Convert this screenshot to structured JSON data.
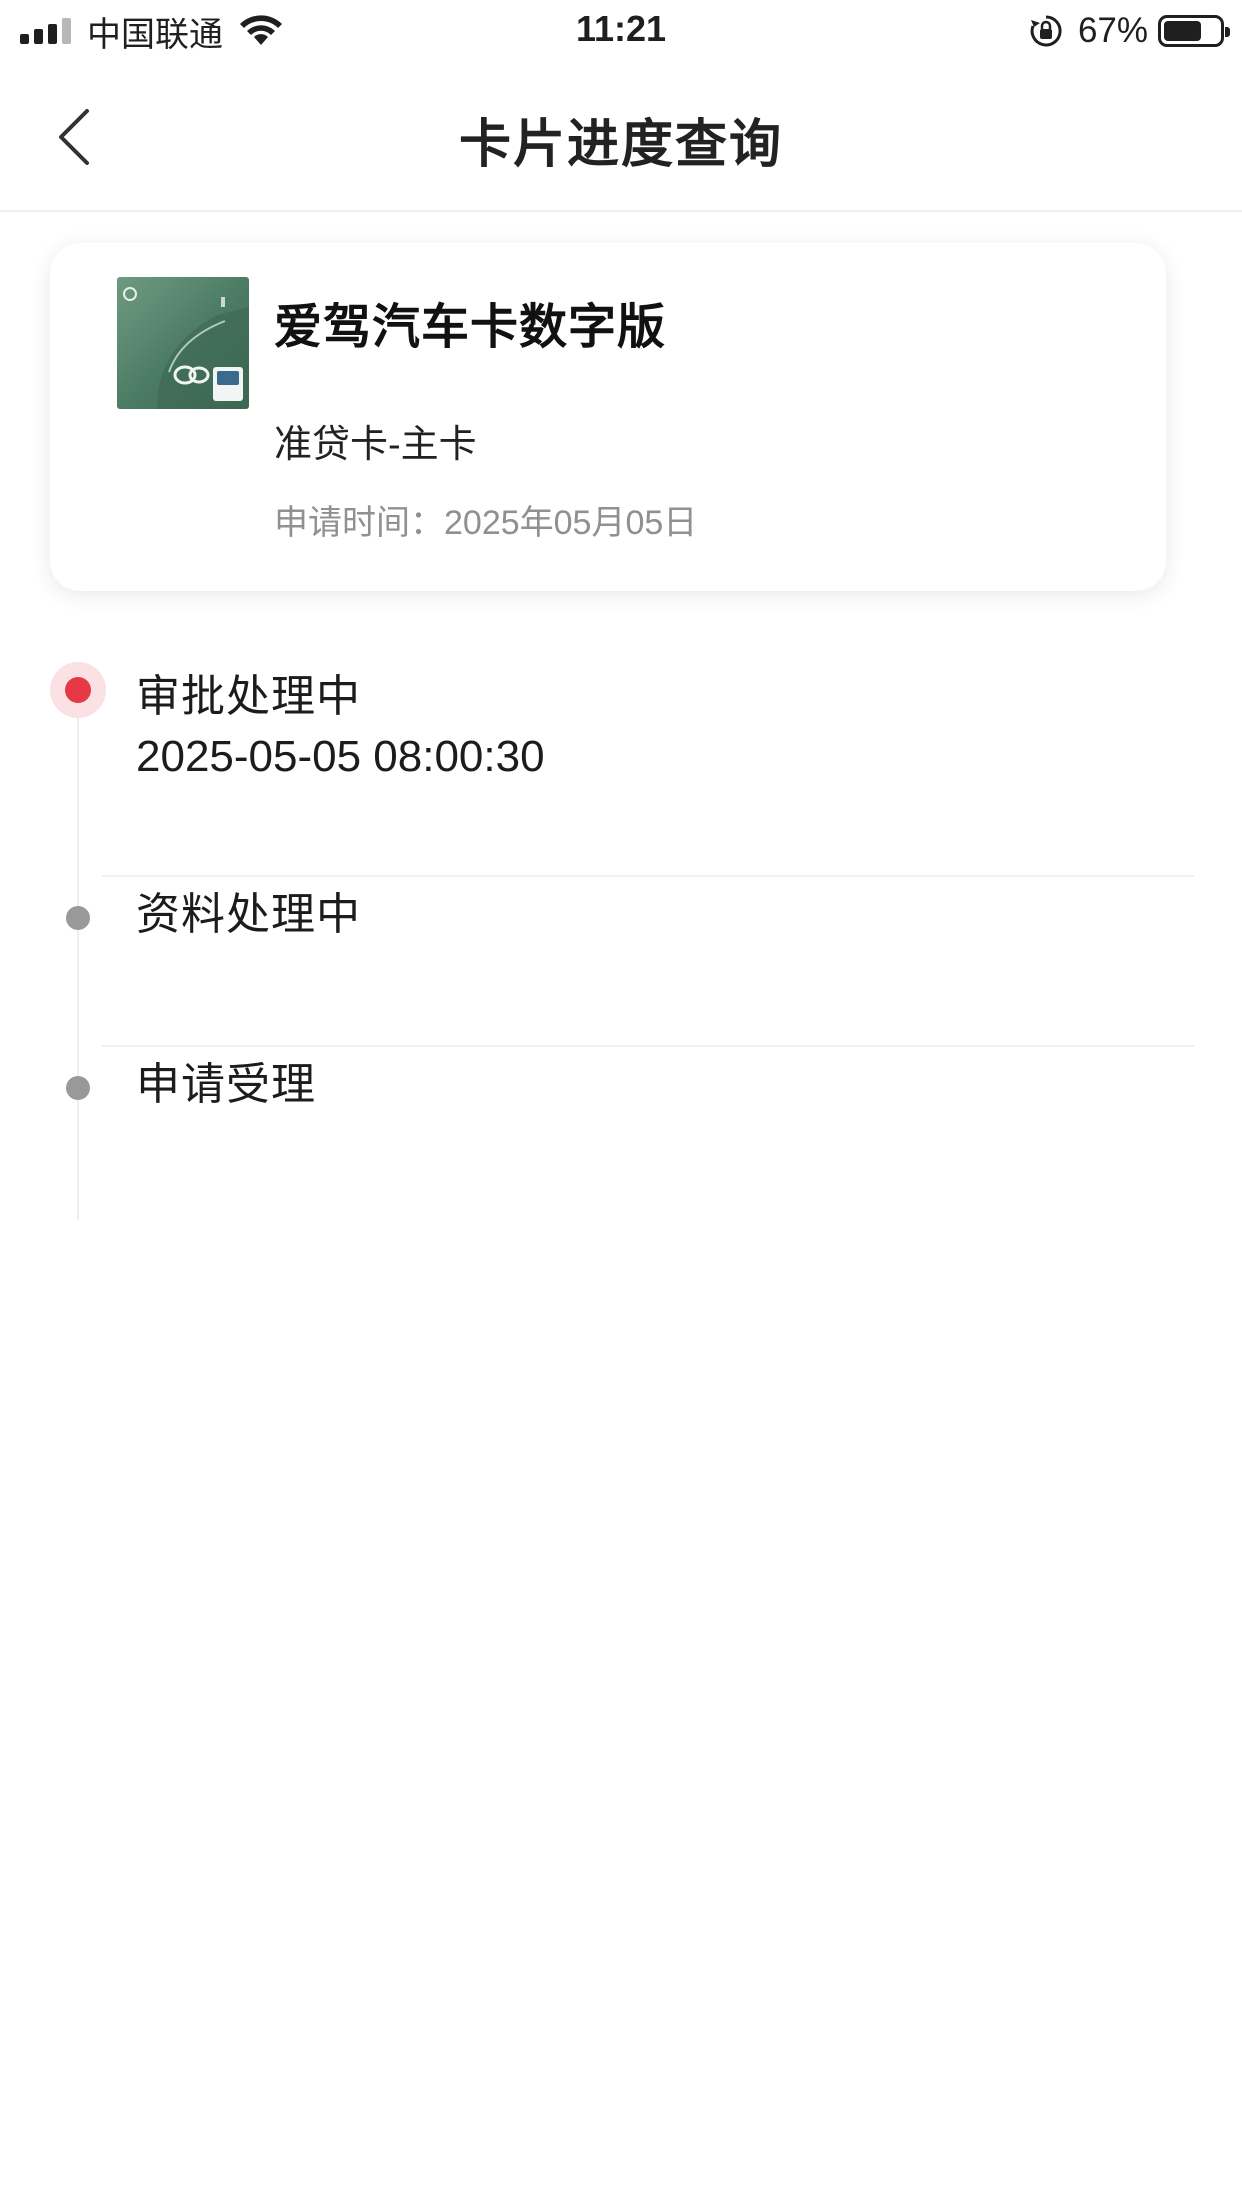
{
  "status_bar": {
    "carrier": "中国联通",
    "time": "11:21",
    "battery_percent": "67%",
    "battery_level": 0.67
  },
  "nav": {
    "title": "卡片进度查询"
  },
  "card": {
    "name": "爱驾汽车卡数字版",
    "type": "准贷卡-主卡",
    "apply_label": "申请时间：",
    "apply_date": "2025年05月05日"
  },
  "timeline": {
    "steps": [
      {
        "title": "审批处理中",
        "time": "2025-05-05 08:00:30",
        "status": "active"
      },
      {
        "title": "资料处理中",
        "status": "pending"
      },
      {
        "title": "申请受理",
        "status": "pending"
      }
    ]
  },
  "colors": {
    "accent": "#e63946",
    "pending_dot": "#999999",
    "muted_text": "#909090"
  }
}
